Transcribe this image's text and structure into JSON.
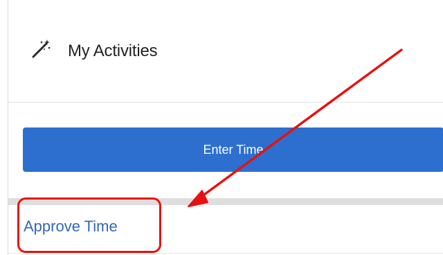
{
  "panel": {
    "title": "My Activities",
    "title_icon": "magic-wand-icon"
  },
  "actions": {
    "enter_time_label": "Enter Time",
    "approve_time_label": "Approve Time",
    "button_color": "#2c6fcf",
    "link_color": "#3366bb"
  },
  "annotation": {
    "color": "#e8110f"
  }
}
